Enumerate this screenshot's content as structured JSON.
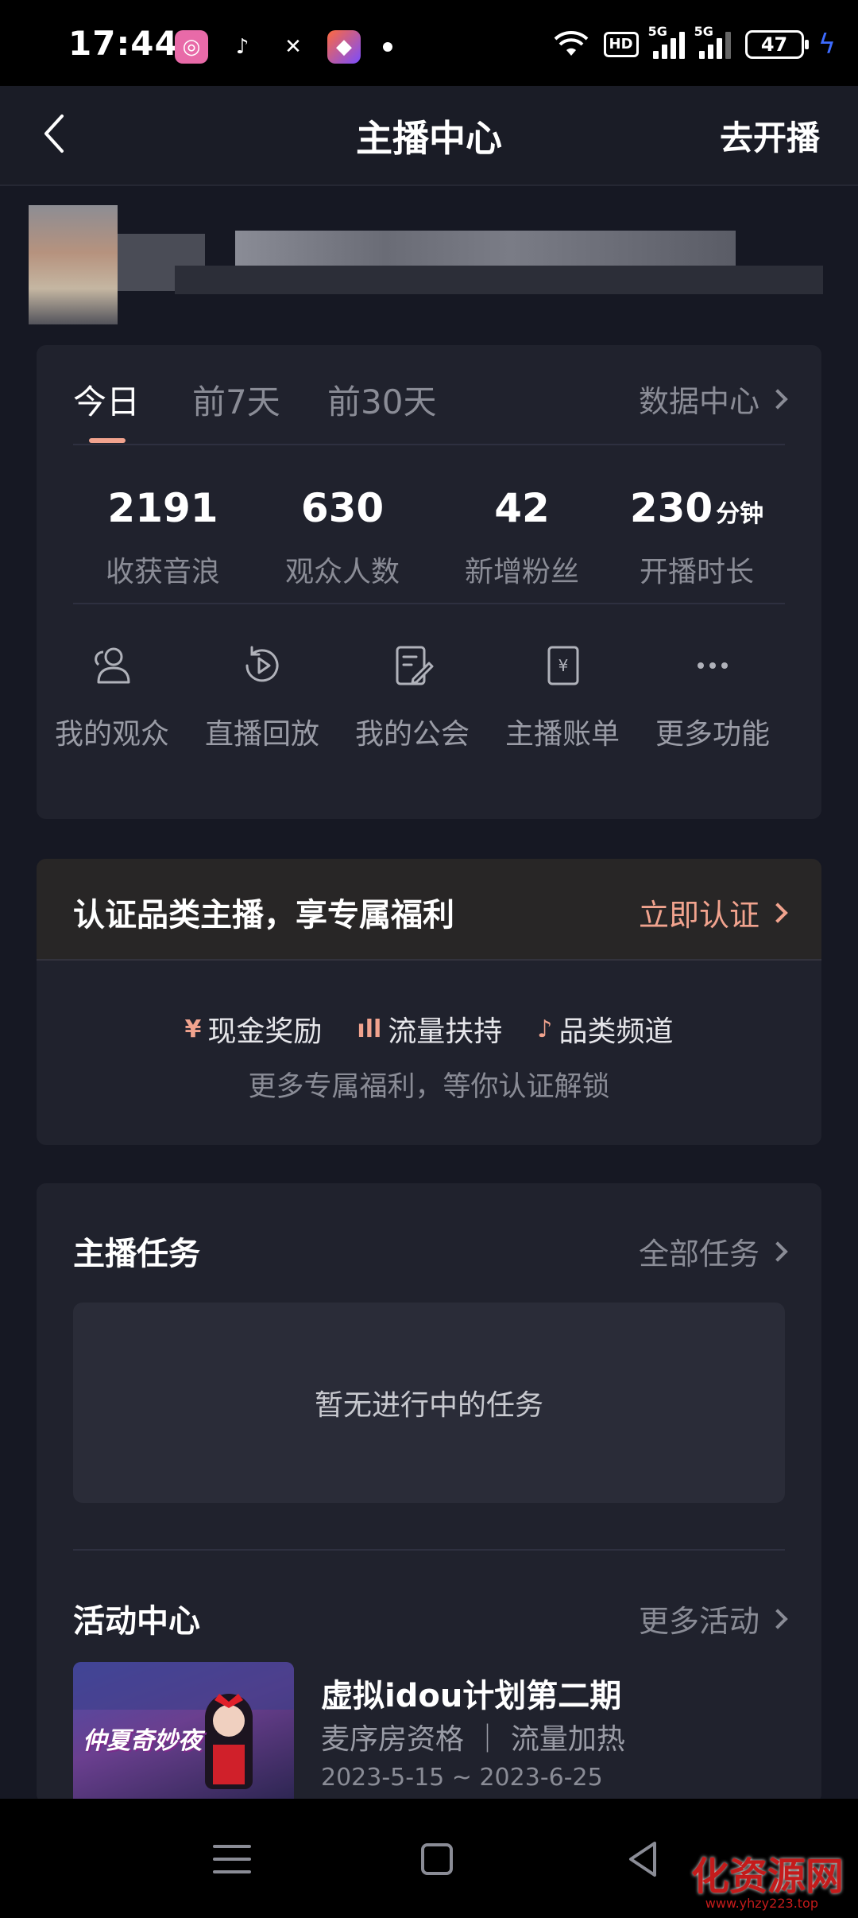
{
  "status_bar": {
    "time": "17:44",
    "network_1": "5G",
    "network_2": "5G",
    "hd_badge": "HD",
    "battery": "47"
  },
  "header": {
    "title": "主播中心",
    "action": "去开播"
  },
  "stats": {
    "tabs": [
      "今日",
      "前7天",
      "前30天"
    ],
    "active_tab": "今日",
    "data_center": "数据中心",
    "items": [
      {
        "value": "2191",
        "unit": "",
        "label": "收获音浪"
      },
      {
        "value": "630",
        "unit": "",
        "label": "观众人数"
      },
      {
        "value": "42",
        "unit": "",
        "label": "新增粉丝"
      },
      {
        "value": "230",
        "unit": "分钟",
        "label": "开播时长"
      }
    ]
  },
  "functions": [
    {
      "label": "我的观众",
      "icon": "audience-icon"
    },
    {
      "label": "直播回放",
      "icon": "replay-icon"
    },
    {
      "label": "我的公会",
      "icon": "guild-icon"
    },
    {
      "label": "主播账单",
      "icon": "bill-icon"
    },
    {
      "label": "更多功能",
      "icon": "more-icon"
    }
  ],
  "certification": {
    "title": "认证品类主播，享专属福利",
    "action": "立即认证",
    "benefits": [
      {
        "icon": "¥",
        "label": "现金奖励"
      },
      {
        "icon": "ıll",
        "label": "流量扶持"
      },
      {
        "icon": "♪",
        "label": "品类频道"
      }
    ],
    "subtitle": "更多专属福利，等你认证解锁"
  },
  "tasks": {
    "title": "主播任务",
    "more": "全部任务",
    "empty": "暂无进行中的任务"
  },
  "activities": {
    "title": "活动中心",
    "more": "更多活动",
    "item": {
      "thumb_text": "仲夏奇妙夜",
      "title": "虚拟idou计划第二期",
      "tags": "麦序房资格 ｜ 流量加热",
      "date": "2023-5-15 ~ 2023-6-25"
    }
  },
  "watermark": {
    "text": "化资源网",
    "url": "www.yhzy223.top"
  },
  "colors": {
    "accent": "#f1a38e",
    "background": "#161823",
    "card": "#20222d"
  }
}
